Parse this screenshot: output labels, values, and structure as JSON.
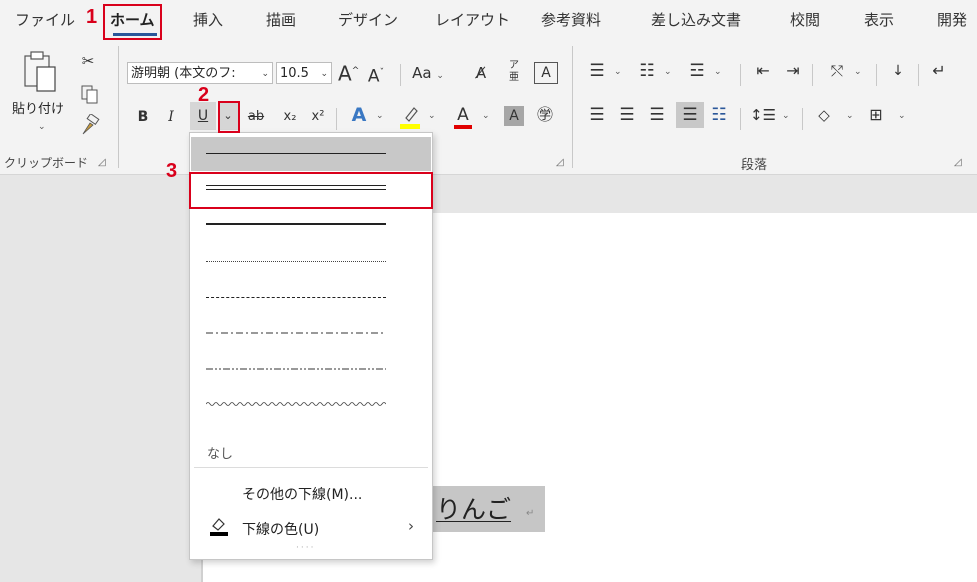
{
  "tabs": [
    "ファイル",
    "ホーム",
    "挿入",
    "描画",
    "デザイン",
    "レイアウト",
    "参考資料",
    "差し込み文書",
    "校閲",
    "表示",
    "開発"
  ],
  "clipboard": {
    "paste_label": "貼り付け",
    "group_label": "クリップボード"
  },
  "font": {
    "font_name": "游明朝 (本文のフ:",
    "font_size": "10.5",
    "bold": "B",
    "italic": "I",
    "underline": "U",
    "subscript": "x₂",
    "superscript": "x²",
    "change_case": "Aa",
    "grow": "A",
    "shrink": "A"
  },
  "paragraph": {
    "group_label": "段落"
  },
  "document": {
    "text": "りんご",
    "paragraph_mark": "↵"
  },
  "underline_menu": {
    "styles": [
      "single",
      "double",
      "thick",
      "dotted",
      "dashed",
      "dash-dot",
      "dash-dot-dot",
      "wave"
    ],
    "none_label": "なし",
    "more_label": "その他の下線(M)...",
    "color_label": "下線の色(U)"
  },
  "annotations": {
    "step1": "1",
    "step2": "2",
    "step3": "3"
  },
  "colors": {
    "accent": "#2b579a",
    "annotation_red": "#d9001b",
    "highlight_yellow": "#ffff00",
    "font_color_red": "#e00000"
  }
}
